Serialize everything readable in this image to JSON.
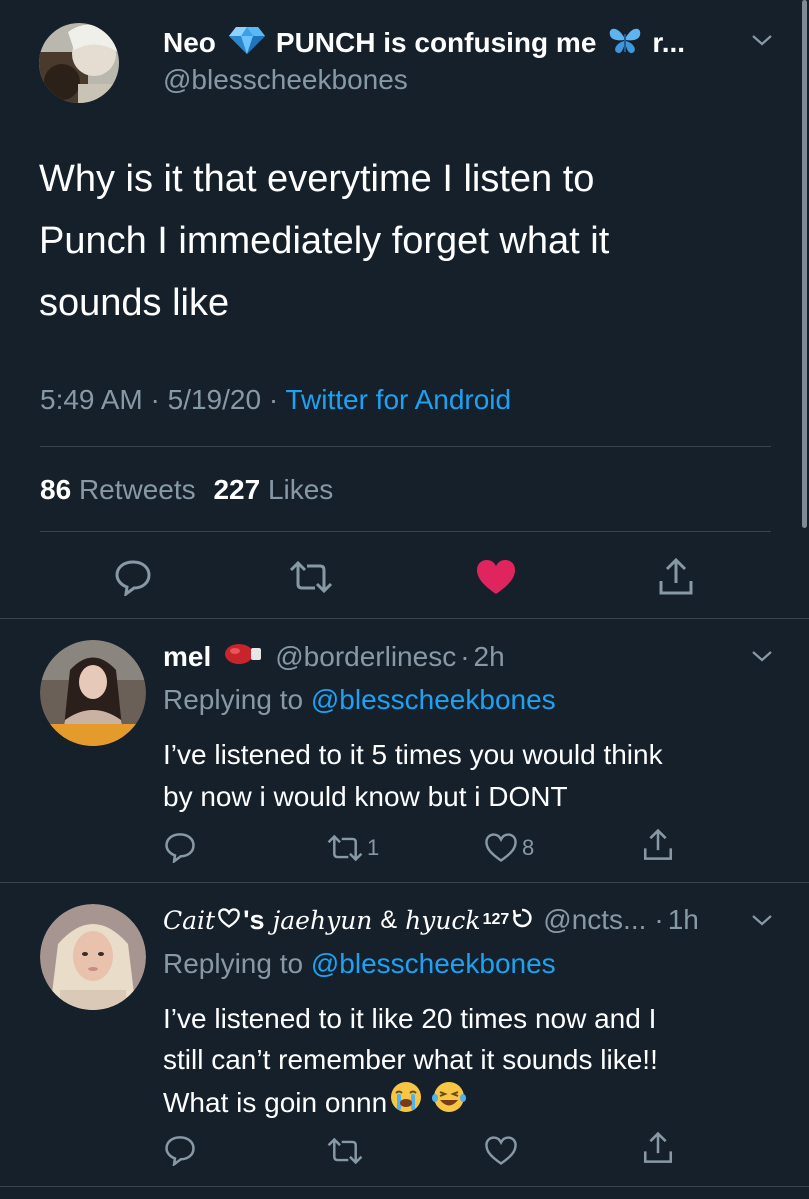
{
  "main_tweet": {
    "display_name": "Neo",
    "display_name_rest": "PUNCH is confusing me",
    "display_name_tail": "r...",
    "handle": "@blesscheekbones",
    "text_lines": [
      "Why is it that everytime I listen to",
      "Punch I immediately forget what it",
      "sounds like"
    ],
    "time": "5:49 AM",
    "date": "5/19/20",
    "source": "Twitter for Android",
    "retweets_count": "86",
    "retweets_label": "Retweets",
    "likes_count": "227",
    "likes_label": "Likes",
    "separator": "·",
    "icons": [
      "reply-icon",
      "retweet-icon",
      "like-icon-filled",
      "share-icon"
    ]
  },
  "replies": [
    {
      "display_name": "mel",
      "handle": "@borderlinesc",
      "dot": "·",
      "time": "2h",
      "replying_prefix": "Replying to",
      "replying_to": "@blesscheekbones",
      "text_lines": [
        "I’ve listened to it 5 times you would think",
        "by now i would know but i DONT"
      ],
      "retweet_count": "1",
      "like_count": "8"
    },
    {
      "display_name_a": "Cait",
      "display_name_b": "'s",
      "display_name_c": "jaehyun",
      "display_name_d": "&",
      "display_name_e": "hyuck",
      "display_name_sup": "127",
      "handle": "@ncts...",
      "dot": "·",
      "time": "1h",
      "replying_prefix": "Replying to",
      "replying_to": "@blesscheekbones",
      "text_lines": [
        "I’ve listened to it like 20 times now and I",
        "still can’t remember what it sounds like!!",
        "What is goin onnn"
      ],
      "emojis": [
        "😭",
        "😂"
      ]
    }
  ],
  "colors": {
    "background": "#15202b",
    "muted": "#8899a6",
    "link": "#1da1f2",
    "like": "#e0245e",
    "divider": "#38444d"
  }
}
